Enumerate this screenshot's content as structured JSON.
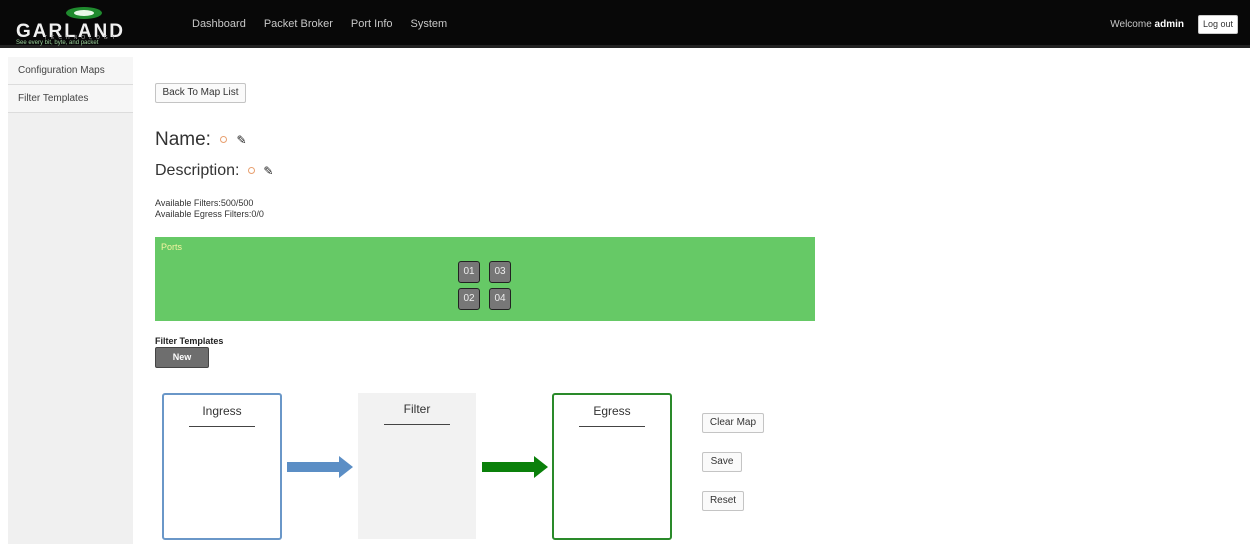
{
  "header": {
    "logo_text": "GARLAND",
    "logo_subtext": "TECHNOLOGY",
    "logo_tagline": "See every bit, byte, and packet",
    "nav": [
      "Dashboard",
      "Packet Broker",
      "Port Info",
      "System"
    ],
    "welcome_prefix": "Welcome",
    "username": "admin",
    "logout_label": "Log out"
  },
  "sidebar": {
    "items": [
      {
        "label": "Configuration Maps"
      },
      {
        "label": "Filter Templates"
      }
    ]
  },
  "main": {
    "back_label": "Back To Map List",
    "name_label": "Name:",
    "description_label": "Description:",
    "available_filters": "Available Filters:500/500",
    "available_egress_filters": "Available Egress Filters:0/0",
    "ports_title": "Ports",
    "ports": [
      "01",
      "03",
      "02",
      "04"
    ],
    "filter_templates_label": "Filter Templates",
    "new_label": "New",
    "ingress_label": "Ingress",
    "filter_label": "Filter",
    "egress_label": "Egress",
    "clear_map_label": "Clear Map",
    "save_label": "Save",
    "reset_label": "Reset"
  },
  "colors": {
    "topbar": "#080808",
    "ports_panel": "#66c966",
    "ingress_border": "#6a97c8",
    "egress_border": "#2a8a2a",
    "arrow_blue": "#5b8ec5",
    "arrow_green": "#0a800a"
  },
  "icons": [
    "edit-pencil-icon",
    "status-circle-icon"
  ]
}
